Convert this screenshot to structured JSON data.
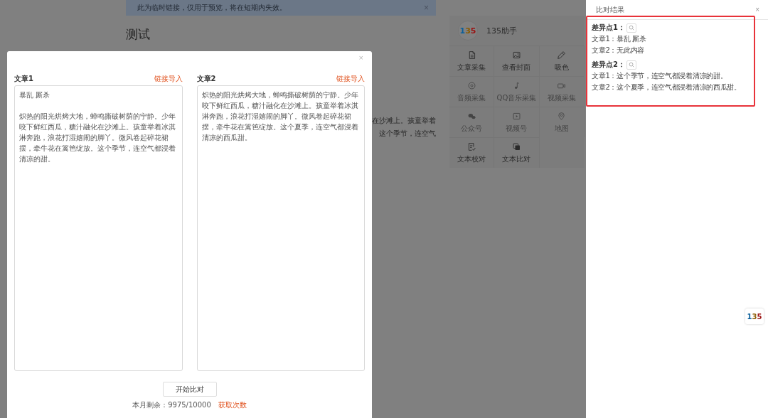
{
  "notice": {
    "text": "此为临时链接，仅用于预览，将在短期内失效。",
    "close": "×"
  },
  "article": {
    "title": "测试",
    "fragments": [
      "在沙滩上。孩童举着",
      "这个季节，连空气"
    ]
  },
  "helper": {
    "logo": "135",
    "name": "135助手",
    "tools": [
      {
        "label": "文章采集",
        "disabled": false
      },
      {
        "label": "查看封面",
        "disabled": false
      },
      {
        "label": "吸色",
        "disabled": false
      },
      {
        "label": "音频采集",
        "disabled": true
      },
      {
        "label": "QQ音乐采集",
        "disabled": true
      },
      {
        "label": "视频采集",
        "disabled": true
      },
      {
        "label": "公众号",
        "disabled": true
      },
      {
        "label": "视频号",
        "disabled": true
      },
      {
        "label": "地图",
        "disabled": true
      },
      {
        "label": "文本校对",
        "disabled": false
      },
      {
        "label": "文本比对",
        "disabled": false
      }
    ]
  },
  "modal": {
    "close": "×",
    "articles": [
      {
        "label": "文章1",
        "link": "链接导入",
        "paragraphs": [
          "暴乱 厮杀",
          "炽热的阳光烘烤大地，蝉鸣撕破树荫的宁静。少年咬下鲜红西瓜，糖汁融化在沙滩上。孩童举着冰淇淋奔跑，浪花打湿嬉闹的脚丫。微风卷起碎花裙摆，牵牛花在篱笆绽放。这个季节，连空气都浸着清凉的甜。"
        ]
      },
      {
        "label": "文章2",
        "link": "链接导入",
        "paragraphs": [
          "炽热的阳光烘烤大地，蝉鸣撕破树荫的宁静。少年咬下鲜红西瓜，糖汁融化在沙滩上。孩童举着冰淇淋奔跑，浪花打湿嬉闹的脚丫。微风卷起碎花裙摆，牵牛花在篱笆绽放。这个夏季，连空气都浸着清凉的西瓜甜。"
        ]
      }
    ],
    "button": "开始比对",
    "quota": "本月剩余：9975/10000",
    "quota_link": "获取次数"
  },
  "results": {
    "title": "比对结果",
    "close": "×",
    "differences": [
      {
        "label": "差异点1：",
        "lines": [
          "文章1：暴乱 厮杀",
          "文章2：无此内容"
        ]
      },
      {
        "label": "差异点2：",
        "lines": [
          "文章1：这个季节，连空气都浸着清凉的甜。",
          "文章2：这个夏季，连空气都浸着清凉的西瓜甜。"
        ]
      }
    ]
  },
  "float_logo": "135"
}
